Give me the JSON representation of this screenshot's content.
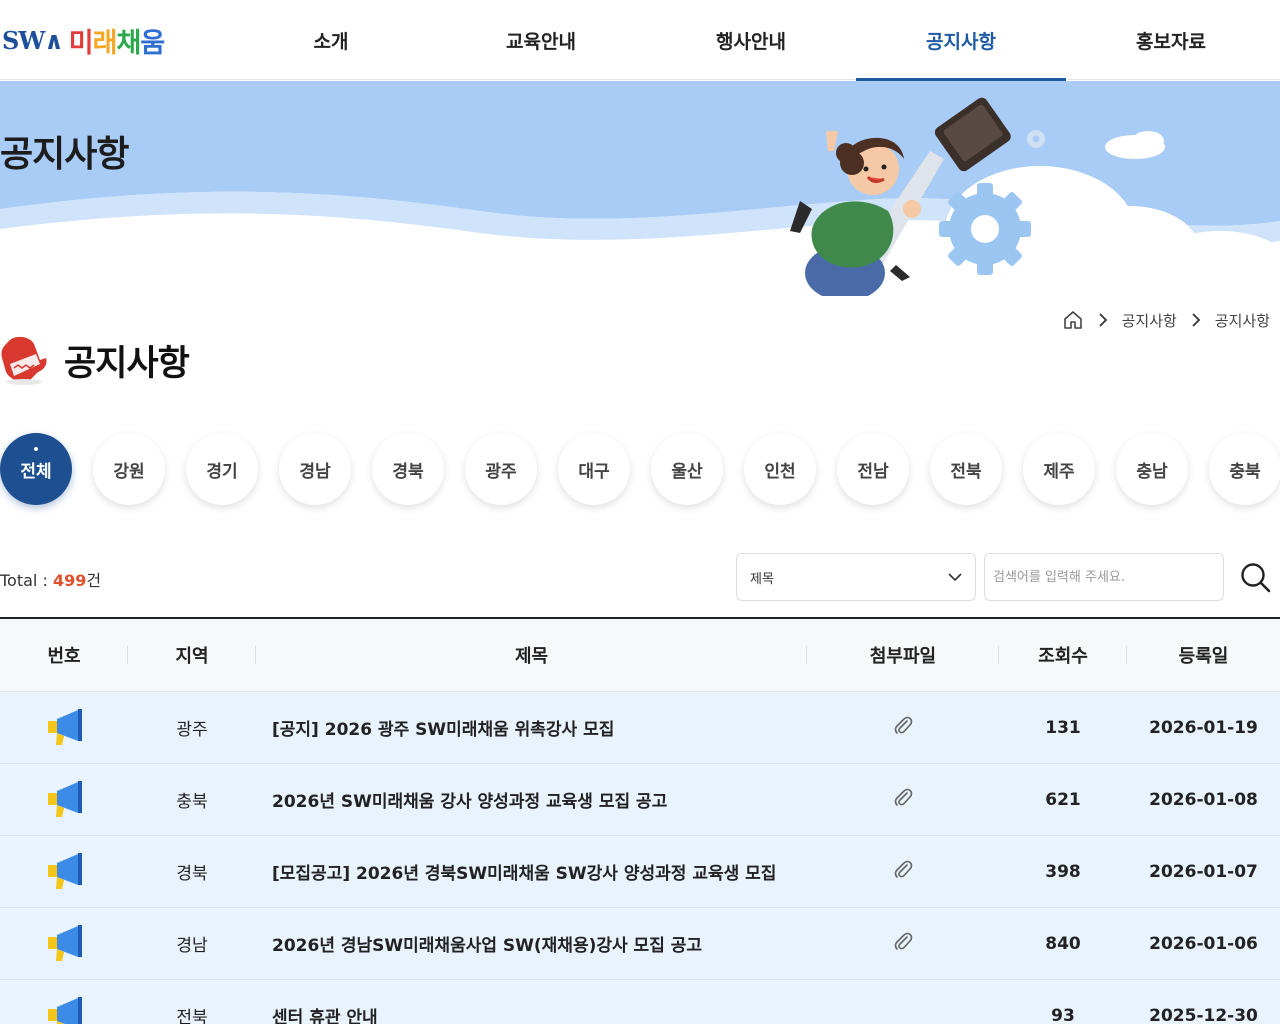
{
  "header": {
    "logo_sw": "SW∧",
    "logo_brand": [
      "미",
      "래",
      "채",
      "움"
    ],
    "brand_colors": [
      "#e23b3b",
      "#f5a623",
      "#2ba84a",
      "#2f6fd1"
    ],
    "nav": [
      "소개",
      "교육안내",
      "행사안내",
      "공지사항",
      "홍보자료"
    ],
    "active_nav": "공지사항",
    "accent": "#1d5aa3"
  },
  "banner": {
    "title": "공지사항"
  },
  "breadcrumb": {
    "home_icon": "home-icon",
    "items": [
      "공지사항",
      "공지사항"
    ]
  },
  "page": {
    "title": "공지사항",
    "icon": "mitten-icon"
  },
  "regions": {
    "items": [
      "전체",
      "강원",
      "경기",
      "경남",
      "경북",
      "광주",
      "대구",
      "울산",
      "인천",
      "전남",
      "전북",
      "제주",
      "충남",
      "충북"
    ],
    "active": "전체"
  },
  "total": {
    "label": "Total : ",
    "count": "499",
    "unit": "건"
  },
  "search": {
    "select_value": "제목",
    "placeholder": "검색어를 입력해 주세요."
  },
  "table": {
    "headers": [
      "번호",
      "지역",
      "제목",
      "첨부파일",
      "조회수",
      "등록일"
    ],
    "rows": [
      {
        "region": "광주",
        "title": "[공지] 2026 광주 SW미래채움 위촉강사 모집",
        "attachment": true,
        "views": "131",
        "date": "2026-01-19"
      },
      {
        "region": "충북",
        "title": "2026년 SW미래채움 강사 양성과정 교육생 모집 공고",
        "attachment": true,
        "views": "621",
        "date": "2026-01-08"
      },
      {
        "region": "경북",
        "title": "[모집공고] 2026년 경북SW미래채움 SW강사 양성과정 교육생 모집",
        "attachment": true,
        "views": "398",
        "date": "2026-01-07"
      },
      {
        "region": "경남",
        "title": "2026년 경남SW미래채움사업 SW(재채용)강사 모집 공고",
        "attachment": true,
        "views": "840",
        "date": "2026-01-06"
      },
      {
        "region": "전북",
        "title": "센터 휴관 안내",
        "attachment": false,
        "views": "93",
        "date": "2025-12-30"
      }
    ]
  }
}
